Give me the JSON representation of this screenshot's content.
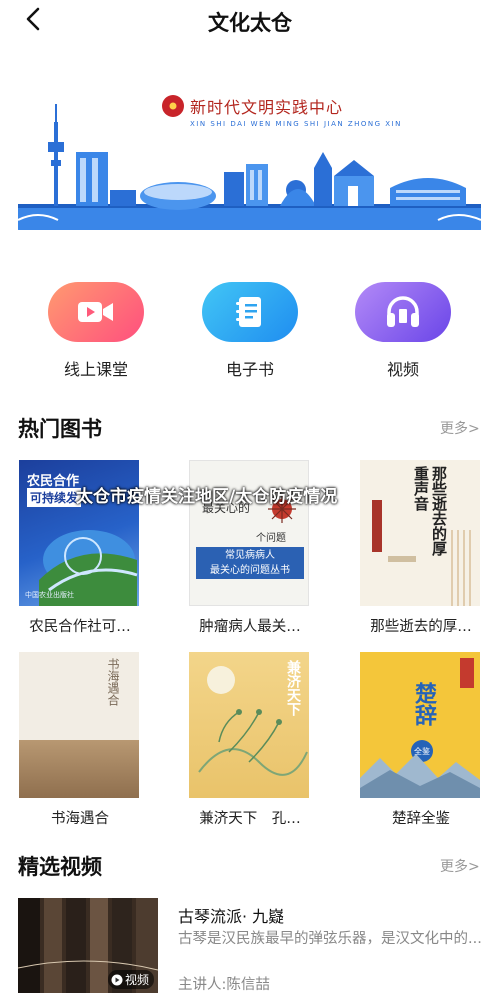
{
  "header": {
    "title": "文化太仓",
    "back_icon": "chevron-left-icon"
  },
  "banner": {
    "title": "新时代文明实践中心",
    "subtitle": "XIN SHI DAI WEN MING SHI JIAN ZHONG XIN",
    "logo_icon": "seal-logo-icon",
    "accent": "#2b6fd6"
  },
  "quick_links": [
    {
      "label": "线上课堂",
      "icon": "video-camera-icon",
      "color": "#ff5a7a"
    },
    {
      "label": "电子书",
      "icon": "notebook-icon",
      "color": "#2fa4f0"
    },
    {
      "label": "视频",
      "icon": "headphones-icon",
      "color": "#8a5cf0"
    }
  ],
  "hot_books": {
    "title": "热门图书",
    "more": "更多>",
    "items": [
      {
        "title": "农民合作社可…"
      },
      {
        "title": "肿瘤病人最关…"
      },
      {
        "title": "那些逝去的厚…"
      },
      {
        "title": "书海遇合"
      },
      {
        "title": "兼济天下　孔…"
      },
      {
        "title": "楚辞全鉴"
      }
    ],
    "covers": {
      "b1": {
        "line1": "农民合作",
        "line2": "可持续发",
        "pub": "中国农业出版社"
      },
      "b2": {
        "top": "最关心的",
        "mid": "个问题",
        "band1": "常见病病人",
        "band2": "最关心的问题丛书"
      },
      "b3": {
        "title": "那些逝去的厚重声音"
      },
      "b4": {
        "title": "书海遇合"
      },
      "b5": {
        "title": "兼济天下"
      },
      "b6": {
        "title": "楚辞",
        "badge": "全鉴"
      }
    }
  },
  "overlay_caption": "太仓市疫情关注地区/太仓防疫情况",
  "videos": {
    "title": "精选视频",
    "more": "更多>",
    "items": [
      {
        "title": "古琴流派· 九嶷",
        "desc": "古琴是汉民族最早的弹弦乐器，是汉文化中的...",
        "speaker": "主讲人:陈信喆",
        "badge": "视频"
      }
    ]
  }
}
